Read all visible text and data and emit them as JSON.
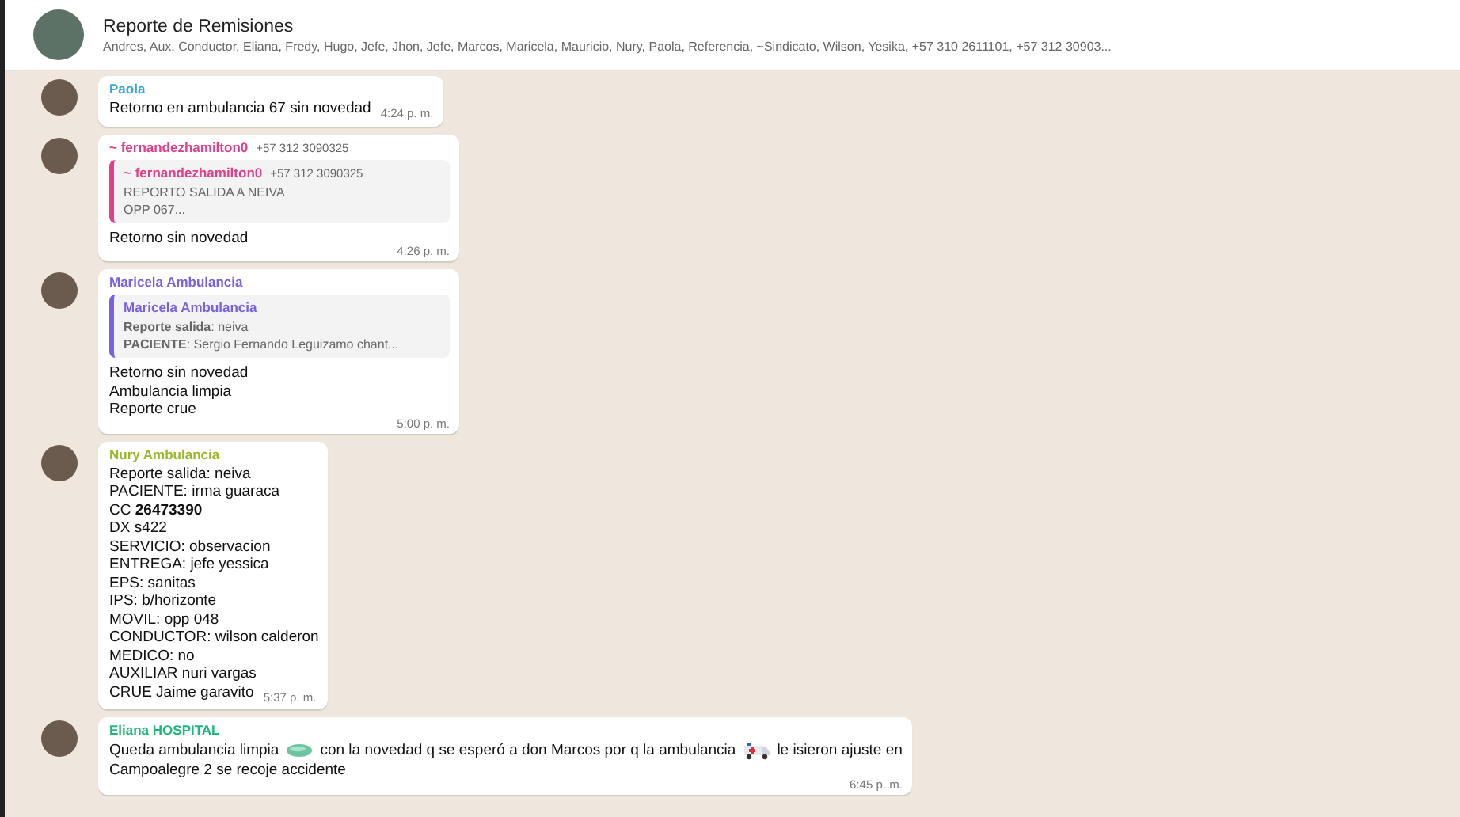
{
  "header": {
    "title": "Reporte de Remisiones",
    "members": "Andres, Aux, Conductor, Eliana, Fredy, Hugo, Jefe, Jhon, Jefe, Marcos, Maricela, Mauricio, Nury, Paola, Referencia, ~Sindicato, Wilson, Yesika, +57 310 2611101, +57 312 30903..."
  },
  "messages": [
    {
      "sender": "Paola",
      "color": "#35a8d8",
      "lines": [
        "Retorno en ambulancia 67 sin novedad"
      ],
      "time": "4:24 p. m."
    },
    {
      "sender": "~ fernandezhamilton0",
      "color": "#e0408a",
      "phone": "+57 312 3090325",
      "quote": {
        "sender": "~ fernandezhamilton0",
        "phone": "+57 312 3090325",
        "color": "#e0408a",
        "lines": [
          "REPORTO SALIDA A NEIVA",
          "OPP 067..."
        ]
      },
      "lines": [
        "Retorno sin novedad"
      ],
      "time": "4:26 p. m."
    },
    {
      "sender": "Maricela Ambulancia",
      "color": "#7b61e0",
      "quote": {
        "sender": "Maricela Ambulancia",
        "color": "#7b61e0",
        "lines": [
          "**Reporte salida**: neiva",
          "**PACIENTE**:  Sergio Fernando Leguizamo chant..."
        ]
      },
      "lines": [
        "Retorno sin novedad",
        "Ambulancia limpia",
        "Reporte crue"
      ],
      "time": "5:00 p. m."
    },
    {
      "sender": "Nury Ambulancia",
      "color": "#9ab82a",
      "lines": [
        "Reporte salida: neiva",
        "PACIENTE: irma guaraca",
        "CC **26473390**",
        "DX s422",
        "SERVICIO: observacion",
        "ENTREGA: jefe yessica",
        "EPS: sanitas",
        "IPS: b/horizonte",
        "MOVIL: opp 048",
        "CONDUCTOR: wilson calderon",
        "MEDICO: no",
        "AUXILIAR nuri vargas",
        "CRUE Jaime garavito"
      ],
      "time": "5:37 p. m."
    },
    {
      "sender": "Eliana HOSPITAL",
      "color": "#1fb87a",
      "segments": [
        {
          "kind": "text",
          "text": "Queda ambulancia limpia"
        },
        {
          "kind": "soap"
        },
        {
          "kind": "text",
          "text": "con la novedad q se esperó a don Marcos por q la ambulancia"
        },
        {
          "kind": "ambulance"
        },
        {
          "kind": "text",
          "text": "le isieron ajuste en"
        },
        {
          "kind": "break"
        },
        {
          "kind": "text",
          "text": "Campoalegre  2 se recoje accidente"
        }
      ],
      "time": "6:45 p. m."
    }
  ]
}
